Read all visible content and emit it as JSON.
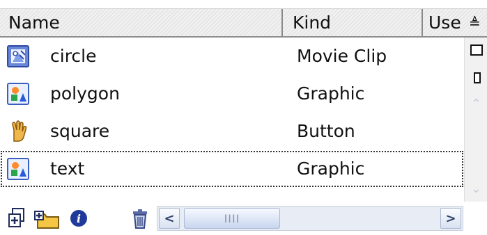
{
  "header": {
    "name_label": "Name",
    "kind_label": "Kind",
    "use_label": "Use",
    "sort_glyph": "≜"
  },
  "rows": [
    {
      "name": "circle",
      "kind": "Movie Clip",
      "icon": "movie-clip-icon"
    },
    {
      "name": "polygon",
      "kind": "Graphic",
      "icon": "graphic-icon"
    },
    {
      "name": "square",
      "kind": "Button",
      "icon": "button-icon"
    },
    {
      "name": "text",
      "kind": "Graphic",
      "icon": "graphic-icon"
    }
  ],
  "selected_row": "text",
  "toolbar": {
    "buttons": [
      "new-symbol-icon",
      "new-folder-icon",
      "properties-icon",
      "delete-icon"
    ],
    "hscroll": {
      "left_glyph": "<",
      "right_glyph": ">",
      "thumb_grip": "IIII"
    }
  },
  "colors": {
    "header_bg": "#ececec",
    "selection_outline": "#333333",
    "scroll_accent": "#aab7cf"
  }
}
